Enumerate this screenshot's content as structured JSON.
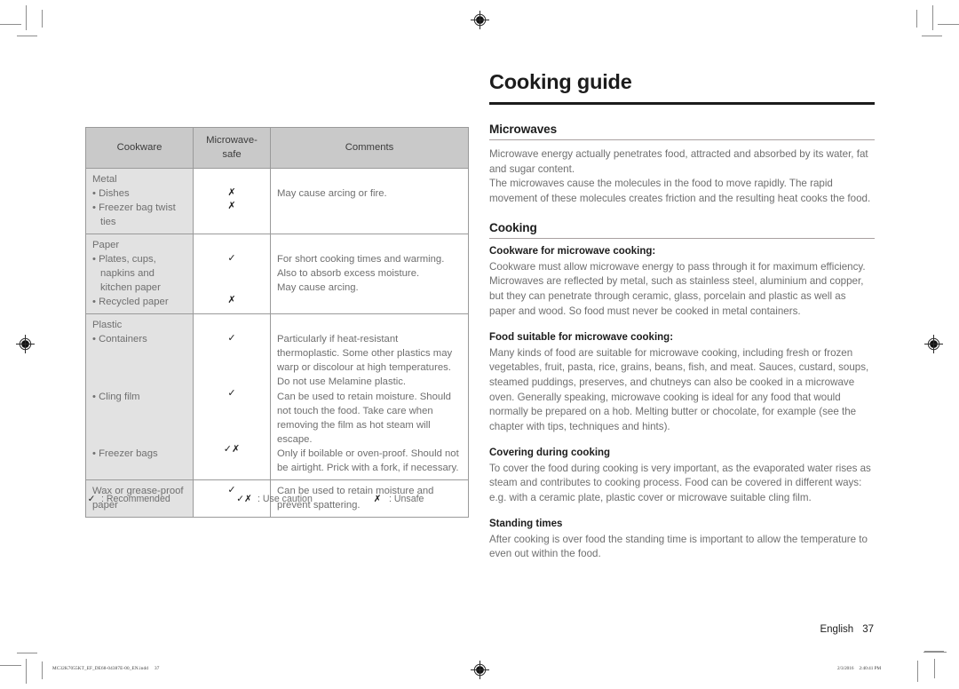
{
  "document": {
    "title": "Cooking guide",
    "folio_language": "English",
    "folio_page": "37",
    "slug_filename": "MC32K7055KT_EF_DE68-04387E-00_EN.indd",
    "slug_page": "37",
    "slug_date": "2/3/2016",
    "slug_time": "2:40:41 PM",
    "rule_color": "#1c1c1c",
    "section_rule_color": "#a9a1a1"
  },
  "table": {
    "name": "Cookware suitability table",
    "headers": [
      "Cookware",
      "Microwave-safe",
      "Comments"
    ],
    "rows": [
      {
        "category": "Metal",
        "items": [
          {
            "label": "Dishes",
            "mark": "✗",
            "comment": "May cause arcing or fire."
          },
          {
            "label": "Freezer bag twist ties",
            "mark": "✗",
            "comment": ""
          }
        ]
      },
      {
        "category": "Paper",
        "items": [
          {
            "label": "Plates, cups, napkins and kitchen paper",
            "mark": "✓",
            "comment": "For short cooking times and warming. Also to absorb excess moisture."
          },
          {
            "label": "Recycled paper",
            "mark": "✗",
            "comment": "May cause arcing."
          }
        ]
      },
      {
        "category": "Plastic",
        "items": [
          {
            "label": "Containers",
            "mark": "✓",
            "comment": "Particularly if heat-resistant thermoplastic. Some other plastics may warp or discolour at high temperatures. Do not use Melamine plastic."
          },
          {
            "label": "Cling film",
            "mark": "✓",
            "comment": "Can be used to retain moisture. Should not touch the food. Take care when removing the film as hot steam will escape."
          },
          {
            "label": "Freezer bags",
            "mark": "✓✗",
            "comment": "Only if boilable or oven-proof. Should not be airtight. Prick with a fork, if necessary."
          }
        ]
      },
      {
        "category": "Wax or grease-proof paper",
        "items": [
          {
            "label": "",
            "mark": "✓",
            "comment": "Can be used to retain moisture and prevent spattering."
          }
        ]
      }
    ]
  },
  "legend": [
    {
      "symbol": "✓",
      "text": ": Recommended"
    },
    {
      "symbol": "✓✗",
      "text": ": Use caution"
    },
    {
      "symbol": "✗",
      "text": ": Unsafe"
    }
  ],
  "microwaves": {
    "heading": "Microwaves",
    "paragraph": "Microwave energy actually penetrates food, attracted and absorbed by its water, fat and sugar content.\nThe microwaves cause the molecules in the food to move rapidly. The rapid movement of these molecules creates friction and the resulting heat cooks the food."
  },
  "cooking": {
    "heading": "Cooking",
    "blocks": [
      {
        "subheading": "Cookware for microwave cooking:",
        "paragraph": "Cookware must allow microwave energy to pass through it for maximum efficiency. Microwaves are reflected by metal, such as stainless steel, aluminium and copper, but they can penetrate through ceramic, glass, porcelain and plastic as well as paper and wood. So food must never be cooked in metal containers."
      },
      {
        "subheading": "Food suitable for microwave cooking:",
        "paragraph": "Many kinds of food are suitable for microwave cooking, including fresh or frozen vegetables, fruit, pasta, rice, grains, beans, fish, and meat. Sauces, custard, soups, steamed puddings, preserves, and chutneys can also be cooked in a microwave oven. Generally speaking, microwave cooking is ideal for any food that would normally be prepared on a hob. Melting butter or chocolate, for example (see the chapter with tips, techniques and hints)."
      },
      {
        "subheading": "Covering during cooking",
        "paragraph": "To cover the food during cooking is very important, as the evaporated water rises as steam and contributes to cooking process. Food can be covered in different ways: e.g. with a ceramic plate, plastic cover or microwave suitable cling film."
      },
      {
        "subheading": "Standing times",
        "paragraph": "After cooking is over food the standing time is important to allow the temperature to even out within the food."
      }
    ]
  }
}
